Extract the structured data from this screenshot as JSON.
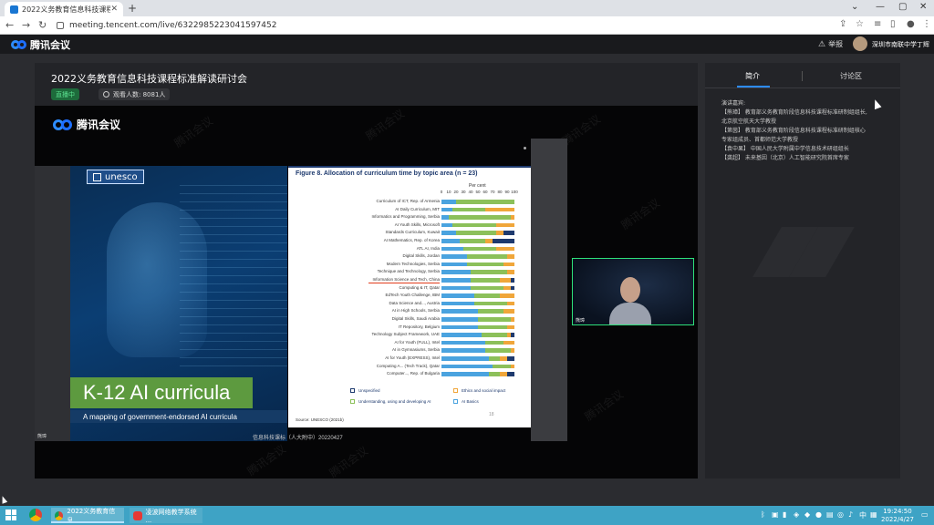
{
  "browser": {
    "tab_title": "2022义务教育信息科技课程标",
    "url": "meeting.tencent.com/live/6322985223041597452",
    "new_tab": "+",
    "close": "✕",
    "minimize": "—",
    "maximize": "▢",
    "caret": "⌄"
  },
  "app": {
    "brand": "腾讯会议",
    "report": "举报",
    "user": "深圳市南联中学丁辉"
  },
  "main": {
    "title": "2022义务教育信息科技课程标准解读研讨会",
    "live_badge": "直播中",
    "viewers": "观看人数: 8081人"
  },
  "video": {
    "brand": "腾讯会议",
    "watermark": "腾讯会议",
    "speaker_label": "熊璋",
    "bottom_label": "熊璋"
  },
  "slide": {
    "unesco": "unesco",
    "k12": "K-12 AI curricula",
    "subtitle": "A mapping of government-endorsed AI curricula",
    "strip_text": "信息科技课标（人大附中）20220427",
    "figure_title": "Figure 8. Allocation of curriculum time by topic area (n = 23)",
    "percent_label": "Per cent",
    "xticks": [
      "0",
      "10",
      "20",
      "30",
      "40",
      "50",
      "60",
      "70",
      "80",
      "90",
      "100"
    ],
    "source": "Source: UNESCO (2021b)",
    "page_number": "18",
    "legend": [
      {
        "label": "Unspecified",
        "color": "#1e3a6e"
      },
      {
        "label": "Ethics and social impact",
        "color": "#f0a63a"
      },
      {
        "label": "Understanding, using and developing AI",
        "color": "#8cc05a"
      },
      {
        "label": "AI Basics",
        "color": "#4aa3df"
      }
    ],
    "rows": [
      {
        "label": "Curriculum of ICT, Rep. of Armenia",
        "values": [
          0,
          0,
          80,
          20
        ]
      },
      {
        "label": "AI Daily Curriculum, MIT",
        "values": [
          0,
          40,
          45,
          15
        ]
      },
      {
        "label": "Informatics and Programming, Serbia",
        "values": [
          0,
          5,
          85,
          10
        ]
      },
      {
        "label": "AI Youth Skills, Microsoft",
        "values": [
          0,
          25,
          60,
          15
        ]
      },
      {
        "label": "Standards Curriculum, Kuwait",
        "values": [
          15,
          10,
          55,
          20
        ]
      },
      {
        "label": "AI Mathematics, Rep. of Korea",
        "values": [
          30,
          10,
          35,
          25
        ]
      },
      {
        "label": "ATL AI, India",
        "values": [
          0,
          25,
          45,
          30
        ]
      },
      {
        "label": "Digital Skills, Jordan",
        "values": [
          0,
          10,
          55,
          35
        ]
      },
      {
        "label": "Modern Technologies, Serbia",
        "values": [
          0,
          15,
          50,
          35
        ]
      },
      {
        "label": "Technique and Technology, Serbia",
        "values": [
          0,
          10,
          50,
          40
        ]
      },
      {
        "label": "Information Science and Tech, China",
        "values": [
          5,
          15,
          40,
          40
        ]
      },
      {
        "label": "Computing & IT, Qatar",
        "values": [
          5,
          10,
          45,
          40
        ]
      },
      {
        "label": "EdTech Youth Challenge, IBM",
        "values": [
          0,
          20,
          35,
          45
        ]
      },
      {
        "label": "Data Science and..., Austria",
        "values": [
          0,
          10,
          45,
          45
        ]
      },
      {
        "label": "AI in High Schools, Serbia",
        "values": [
          0,
          15,
          35,
          50
        ]
      },
      {
        "label": "Digital Skills, Saudi Arabia",
        "values": [
          0,
          5,
          45,
          50
        ]
      },
      {
        "label": "IT Repository, Belgium",
        "values": [
          0,
          10,
          40,
          50
        ]
      },
      {
        "label": "Technology Subject Framework, UAE",
        "values": [
          5,
          5,
          35,
          55
        ]
      },
      {
        "label": "AI for Youth (FULL), Intel",
        "values": [
          0,
          15,
          25,
          60
        ]
      },
      {
        "label": "AI in Gymnasiums, Serbia",
        "values": [
          0,
          5,
          35,
          60
        ]
      },
      {
        "label": "AI for Youth (EXPRESS), Intel",
        "values": [
          10,
          10,
          15,
          65
        ]
      },
      {
        "label": "Computing A... (Tech Track), Qatar",
        "values": [
          0,
          5,
          25,
          70
        ]
      },
      {
        "label": "Computer..., Rep. of Bulgaria",
        "values": [
          10,
          10,
          15,
          65
        ]
      }
    ]
  },
  "side": {
    "tab_intro": "简介",
    "tab_discuss": "讨论区",
    "intro_lines": [
      "演讲嘉宾:",
      "【熊璋】 教育部义务教育阶段信息科技课程标准研制组组长,",
      "北京航空航天大学教授",
      "【第茵】 教育部义务教育阶段信息科技课程标准研制组核心",
      "专家组成员、首都师范大学教授",
      "【袁中果】 中国人民大学附属中学信息技术研组组长",
      "【龚超】 未来基因（北京）人工智能研究院首席专家"
    ]
  },
  "taskbar": {
    "app1": "2022义务教育信息...",
    "app2": "凌波网络教学系统 ...",
    "time": "19:24:50",
    "date": "2022/4/27",
    "lang": "中"
  }
}
